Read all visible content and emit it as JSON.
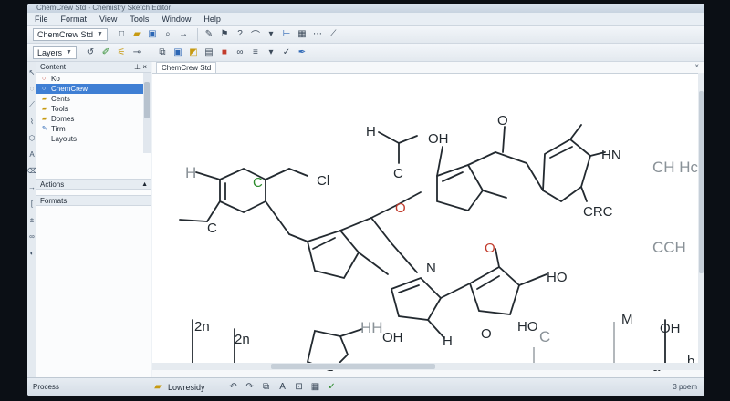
{
  "window": {
    "title": "ChemCrew Std - Chemistry Sketch Editor"
  },
  "menu": [
    "File",
    "Format",
    "View",
    "Tools",
    "Window",
    "Help"
  ],
  "toolbar1": {
    "style_combo": "ChemCrew Std"
  },
  "toolbar2": {
    "layer_combo": "Layers"
  },
  "panel": {
    "title": "Content",
    "items": [
      {
        "label": "Ko",
        "selected": false
      },
      {
        "label": "ChemCrew",
        "selected": true
      },
      {
        "label": "Cents",
        "selected": false
      },
      {
        "label": "Tools",
        "selected": false
      },
      {
        "label": "Domes",
        "selected": false
      },
      {
        "label": "Tirm",
        "selected": false
      },
      {
        "label": "Layouts",
        "selected": false
      }
    ],
    "section2": "Actions",
    "section3": "Formats"
  },
  "document": {
    "tab": "ChemCrew Std"
  },
  "molecule_labels": {
    "h": "H",
    "c1": "C",
    "oh_top": "OH",
    "o_top": "O",
    "hn_top": "HN",
    "cl_left": "Cl",
    "c_left": "C",
    "h_left": "H",
    "o_red": "O",
    "crc": "CRC",
    "c_red_ring": "O",
    "ho_right": "HO",
    "ch3_label": "CH Hcn",
    "cch_label": "CCH",
    "zn1": "2n",
    "zn2": "2n",
    "hh": "HH",
    "oi": "OH",
    "h_bottom": "H",
    "ho_bottom": "HO",
    "m_label": "M",
    "oh_label": "OH",
    "b_label": "b",
    "a_label": "a",
    "c_small": "C",
    "o_small": "O",
    "n_small": "N",
    "pc": "C"
  },
  "status": {
    "left": "Process",
    "mode": "Lowresidy",
    "page": "3 poem"
  },
  "colors": {
    "selection": "#3f7fd4",
    "accent_red": "#c23b2c",
    "accent_green": "#2c8b2c"
  }
}
